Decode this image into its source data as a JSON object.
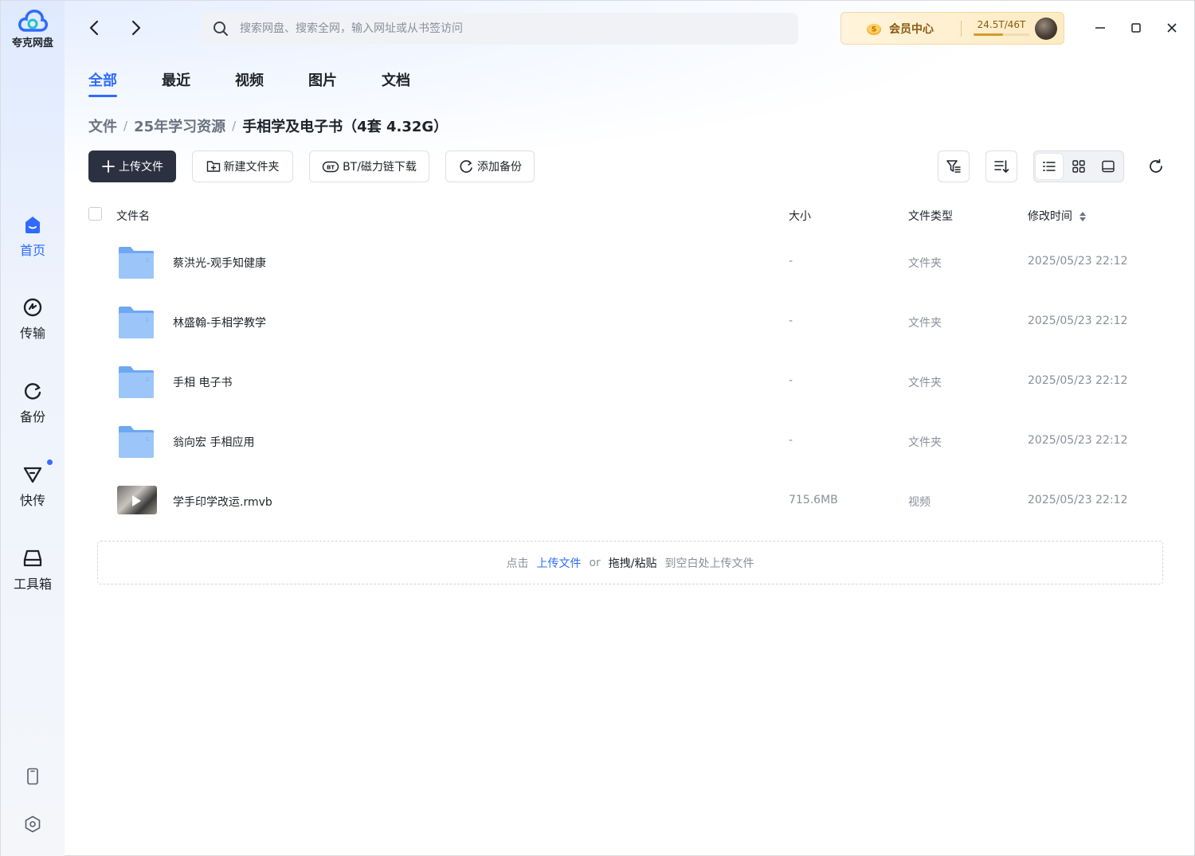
{
  "app": {
    "name": "夸克网盘"
  },
  "sidebar": {
    "items": [
      {
        "label": "首页",
        "icon": "home-icon",
        "active": true
      },
      {
        "label": "传输",
        "icon": "transfer-icon",
        "active": false
      },
      {
        "label": "备份",
        "icon": "backup-icon",
        "active": false
      },
      {
        "label": "快传",
        "icon": "quick-send-icon",
        "active": false,
        "badge": true
      },
      {
        "label": "工具箱",
        "icon": "toolbox-icon",
        "active": false
      }
    ],
    "bottom_icons": [
      "phone-icon",
      "settings-icon"
    ]
  },
  "header": {
    "search_placeholder": "搜索网盘、搜索全网，输入网址或从书签访问",
    "vip_label": "会员中心",
    "quota_text": "24.5T/46T",
    "quota_fraction": 0.53
  },
  "tabs": [
    {
      "label": "全部",
      "active": true
    },
    {
      "label": "最近",
      "active": false
    },
    {
      "label": "视频",
      "active": false
    },
    {
      "label": "图片",
      "active": false
    },
    {
      "label": "文档",
      "active": false
    }
  ],
  "breadcrumb": {
    "items": [
      "文件",
      "25年学习资源"
    ],
    "current": "手相学及电子书（4套 4.32G）"
  },
  "toolbar": {
    "upload": "上传文件",
    "new_folder": "新建文件夹",
    "bt_download": "BT/磁力链下载",
    "add_backup": "添加备份"
  },
  "table": {
    "columns": {
      "name": "文件名",
      "size": "大小",
      "type": "文件类型",
      "modified": "修改时间"
    },
    "rows": [
      {
        "name": "蔡洪光-观手知健康",
        "size": "-",
        "type": "文件夹",
        "modified": "2025/05/23 22:12",
        "kind": "folder"
      },
      {
        "name": "林盛翰-手相学教学",
        "size": "-",
        "type": "文件夹",
        "modified": "2025/05/23 22:12",
        "kind": "folder"
      },
      {
        "name": "手相 电子书",
        "size": "-",
        "type": "文件夹",
        "modified": "2025/05/23 22:12",
        "kind": "folder"
      },
      {
        "name": "翁向宏 手相应用",
        "size": "-",
        "type": "文件夹",
        "modified": "2025/05/23 22:12",
        "kind": "folder"
      },
      {
        "name": "学手印学改运.rmvb",
        "size": "715.6MB",
        "type": "视频",
        "modified": "2025/05/23 22:12",
        "kind": "video"
      }
    ]
  },
  "drop_zone": {
    "prefix": "点击",
    "link": "上传文件",
    "or": "or",
    "action": "拖拽/粘贴",
    "suffix": "到空白处上传文件"
  },
  "colors": {
    "accent": "#2f6bff",
    "primary_button": "#2b3140",
    "folder": "#7fb3f5"
  }
}
